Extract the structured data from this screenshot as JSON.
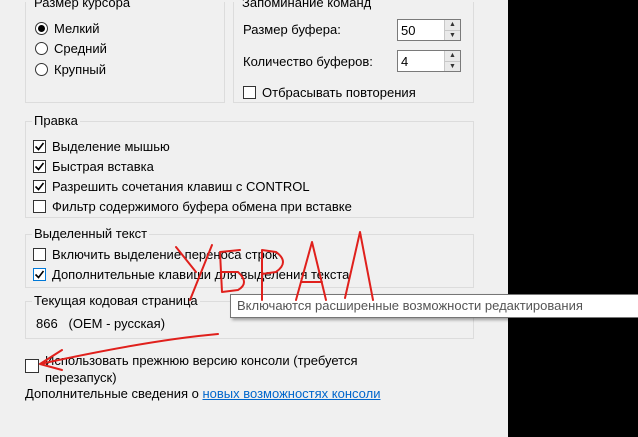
{
  "cursor_size": {
    "legend": "Размер курсора",
    "options": [
      {
        "label": "Мелкий",
        "checked": true
      },
      {
        "label": "Средний",
        "checked": false
      },
      {
        "label": "Крупный",
        "checked": false
      }
    ]
  },
  "history": {
    "legend": "Запоминание команд",
    "buffer_size_label": "Размер буфера:",
    "buffer_size_value": "50",
    "buffer_count_label": "Количество буферов:",
    "buffer_count_value": "4",
    "discard_duplicates": {
      "label": "Отбрасывать повторения",
      "checked": false
    }
  },
  "edit": {
    "legend": "Правка",
    "options": [
      {
        "label": "Выделение мышью",
        "checked": true
      },
      {
        "label": "Быстрая вставка",
        "checked": true
      },
      {
        "label": "Разрешить сочетания клавиш с CONTROL",
        "checked": true
      },
      {
        "label": "Фильтр содержимого буфера обмена при вставке",
        "checked": false
      }
    ]
  },
  "selection": {
    "legend": "Выделенный текст",
    "options": [
      {
        "label": "Включить выделение переноса строк",
        "checked": false
      },
      {
        "label": "Дополнительные клавиши для выделения текста",
        "checked": true
      }
    ]
  },
  "codepage": {
    "legend": "Текущая кодовая страница",
    "value": "866   (OEM - русская)"
  },
  "legacy": {
    "label_line1": "Использовать прежнюю версию консоли (требуется",
    "label_line2": "перезапуск)",
    "checked": false
  },
  "more_info": {
    "prefix": "Дополнительные сведения о ",
    "link": "новых возможностях консоли"
  },
  "tooltip": {
    "text": "Включаются расширенные возможности редактирования"
  },
  "colors": {
    "dialog_bg": "#f0f0f0",
    "link": "#0066cc",
    "scribble": "#e0201c"
  }
}
